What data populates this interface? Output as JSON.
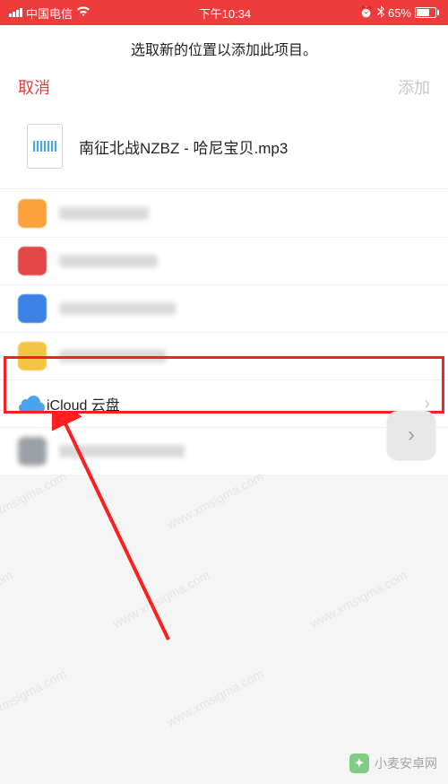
{
  "status": {
    "carrier": "中国电信",
    "time": "下午10:34",
    "battery_pct": "65%"
  },
  "header": {
    "title": "选取新的位置以添加此项目。"
  },
  "nav": {
    "cancel": "取消",
    "add": "添加"
  },
  "file": {
    "name": "南征北战NZBZ - 哈尼宝贝.mp3"
  },
  "locations": {
    "icloud_label": "iCloud 云盘"
  },
  "watermark": {
    "url": "www.xmsigma.com",
    "brand": "小麦安卓网"
  }
}
